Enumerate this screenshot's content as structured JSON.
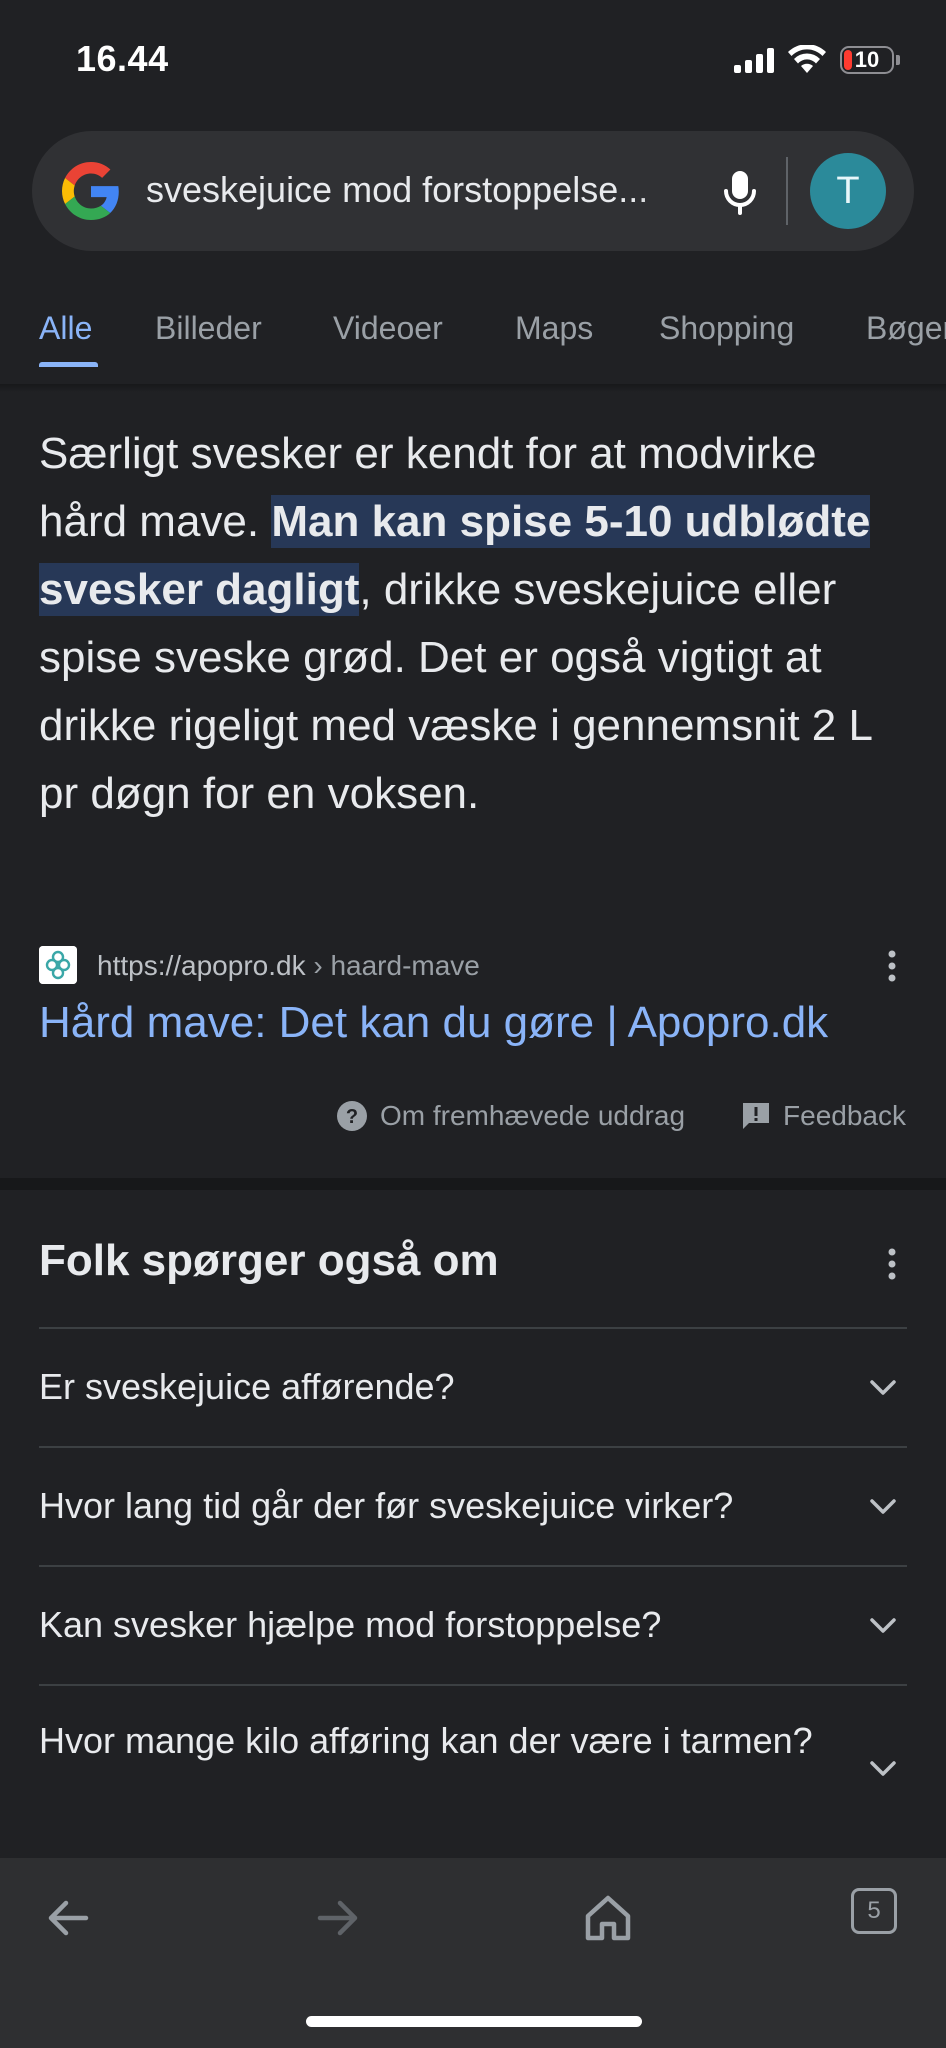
{
  "status_bar": {
    "time": "16.44",
    "battery_level": "10"
  },
  "search": {
    "query": "sveskejuice mod forstoppelse..."
  },
  "account": {
    "initial": "T"
  },
  "tabs": [
    {
      "label": "Alle",
      "active": true
    },
    {
      "label": "Billeder",
      "active": false
    },
    {
      "label": "Videoer",
      "active": false
    },
    {
      "label": "Maps",
      "active": false
    },
    {
      "label": "Shopping",
      "active": false
    },
    {
      "label": "Bøger",
      "active": false
    }
  ],
  "featured_snippet": {
    "text_before": "Særligt svesker er kendt for at modvirke hård mave. ",
    "highlight": "Man kan spise 5-10 udblødte svesker dagligt",
    "text_after": ", drikke sveskejuice eller spise sveske grød. Det er også vigtigt at drikke rigeligt med væske i gennemsnit 2 L pr døgn for en voksen.",
    "source_url": "https://apopro.dk",
    "source_path": " › haard-mave",
    "title": "Hård mave: Det kan du gøre | Apopro.dk",
    "about_label": "Om fremhævede uddrag",
    "feedback_label": "Feedback"
  },
  "people_also_ask": {
    "title": "Folk spørger også om",
    "questions": [
      "Er sveskejuice afførende?",
      "Hvor lang tid går der før sveskejuice virker?",
      "Kan svesker hjælpe mod forstoppelse?",
      "Hvor mange kilo afføring kan der være i tarmen?"
    ]
  },
  "toolbar": {
    "tab_count": "5"
  },
  "colors": {
    "background": "#202124",
    "link": "#8ab4f8",
    "highlight": "#273857",
    "avatar": "#2b8a9a"
  }
}
